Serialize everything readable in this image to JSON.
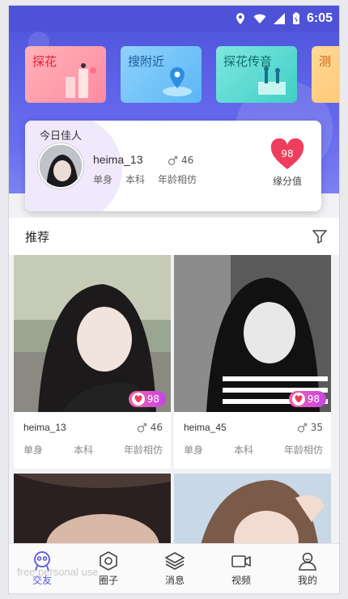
{
  "status_bar": {
    "time": "6:05",
    "icons": [
      "location-icon",
      "wifi-icon",
      "signal-icon",
      "battery-icon"
    ]
  },
  "categories": [
    {
      "label": "探花",
      "color": "#ff7f93",
      "text_color": "#e0203c"
    },
    {
      "label": "搜附近",
      "color": "#6ec0f7",
      "text_color": "#1c5b9e"
    },
    {
      "label": "探花传音",
      "color": "#4fd5d0",
      "text_color": "#0f6b6b"
    },
    {
      "label": "测",
      "color": "#ffc76e",
      "text_color": "#c9631a"
    }
  ],
  "today_star": {
    "title": "今日佳人",
    "name": "heima_13",
    "age": "46",
    "tags": [
      "单身",
      "本科",
      "年龄相仿"
    ],
    "score": "98",
    "score_label": "缘分值"
  },
  "recommend": {
    "title": "推荐",
    "cards": [
      {
        "name": "heima_13",
        "age": "46",
        "score": "98",
        "tags": [
          "单身",
          "本科",
          "年龄相仿"
        ]
      },
      {
        "name": "heima_45",
        "age": "35",
        "score": "98",
        "tags": [
          "单身",
          "本科",
          "年龄相仿"
        ]
      }
    ]
  },
  "tabbar": [
    {
      "label": "交友",
      "icon": "face-icon",
      "active": true
    },
    {
      "label": "圈子",
      "icon": "hexagon-icon",
      "active": false
    },
    {
      "label": "消息",
      "icon": "layers-icon",
      "active": false
    },
    {
      "label": "视频",
      "icon": "video-camera-icon",
      "active": false
    },
    {
      "label": "我的",
      "icon": "user-icon",
      "active": false
    }
  ],
  "watermark": "free personal use",
  "colors": {
    "accent": "#5557e0",
    "header": "#5257dd",
    "heart": "#ef3e5c",
    "pill_start": "#f063a8",
    "pill_end": "#c646e4"
  }
}
